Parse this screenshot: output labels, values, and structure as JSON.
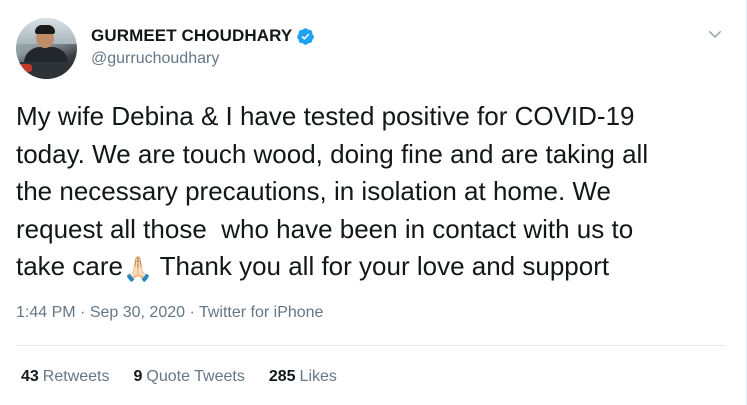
{
  "author": {
    "display_name": "GURMEET CHOUDHARY",
    "handle": "@gurruchoudhary",
    "verified": true
  },
  "tweet": {
    "text_lines": [
      "My wife Debina & I have tested positive for COVID-19",
      "today. We are touch wood, doing fine and are taking all",
      "the necessary precautions, in isolation at home. We",
      "request all those  who have been in contact with us to"
    ],
    "last_line_before_emoji": "take care",
    "emoji": "🙏🏻",
    "last_line_after_emoji": " Thank you all for your love and support"
  },
  "meta": {
    "time": "1:44 PM",
    "separator1": " · ",
    "date": "Sep 30, 2020",
    "separator2": " · ",
    "source": "Twitter for iPhone"
  },
  "stats": {
    "retweets_count": "43",
    "retweets_label": "Retweets",
    "quote_tweets_count": "9",
    "quote_tweets_label": "Quote Tweets",
    "likes_count": "285",
    "likes_label": "Likes"
  },
  "icons": {
    "verified": "verified-badge-icon",
    "caret": "chevron-down-icon"
  },
  "colors": {
    "text": "#14171a",
    "secondary": "#657786",
    "verified_blue": "#1da1f2",
    "divider": "#e6ecf0"
  }
}
